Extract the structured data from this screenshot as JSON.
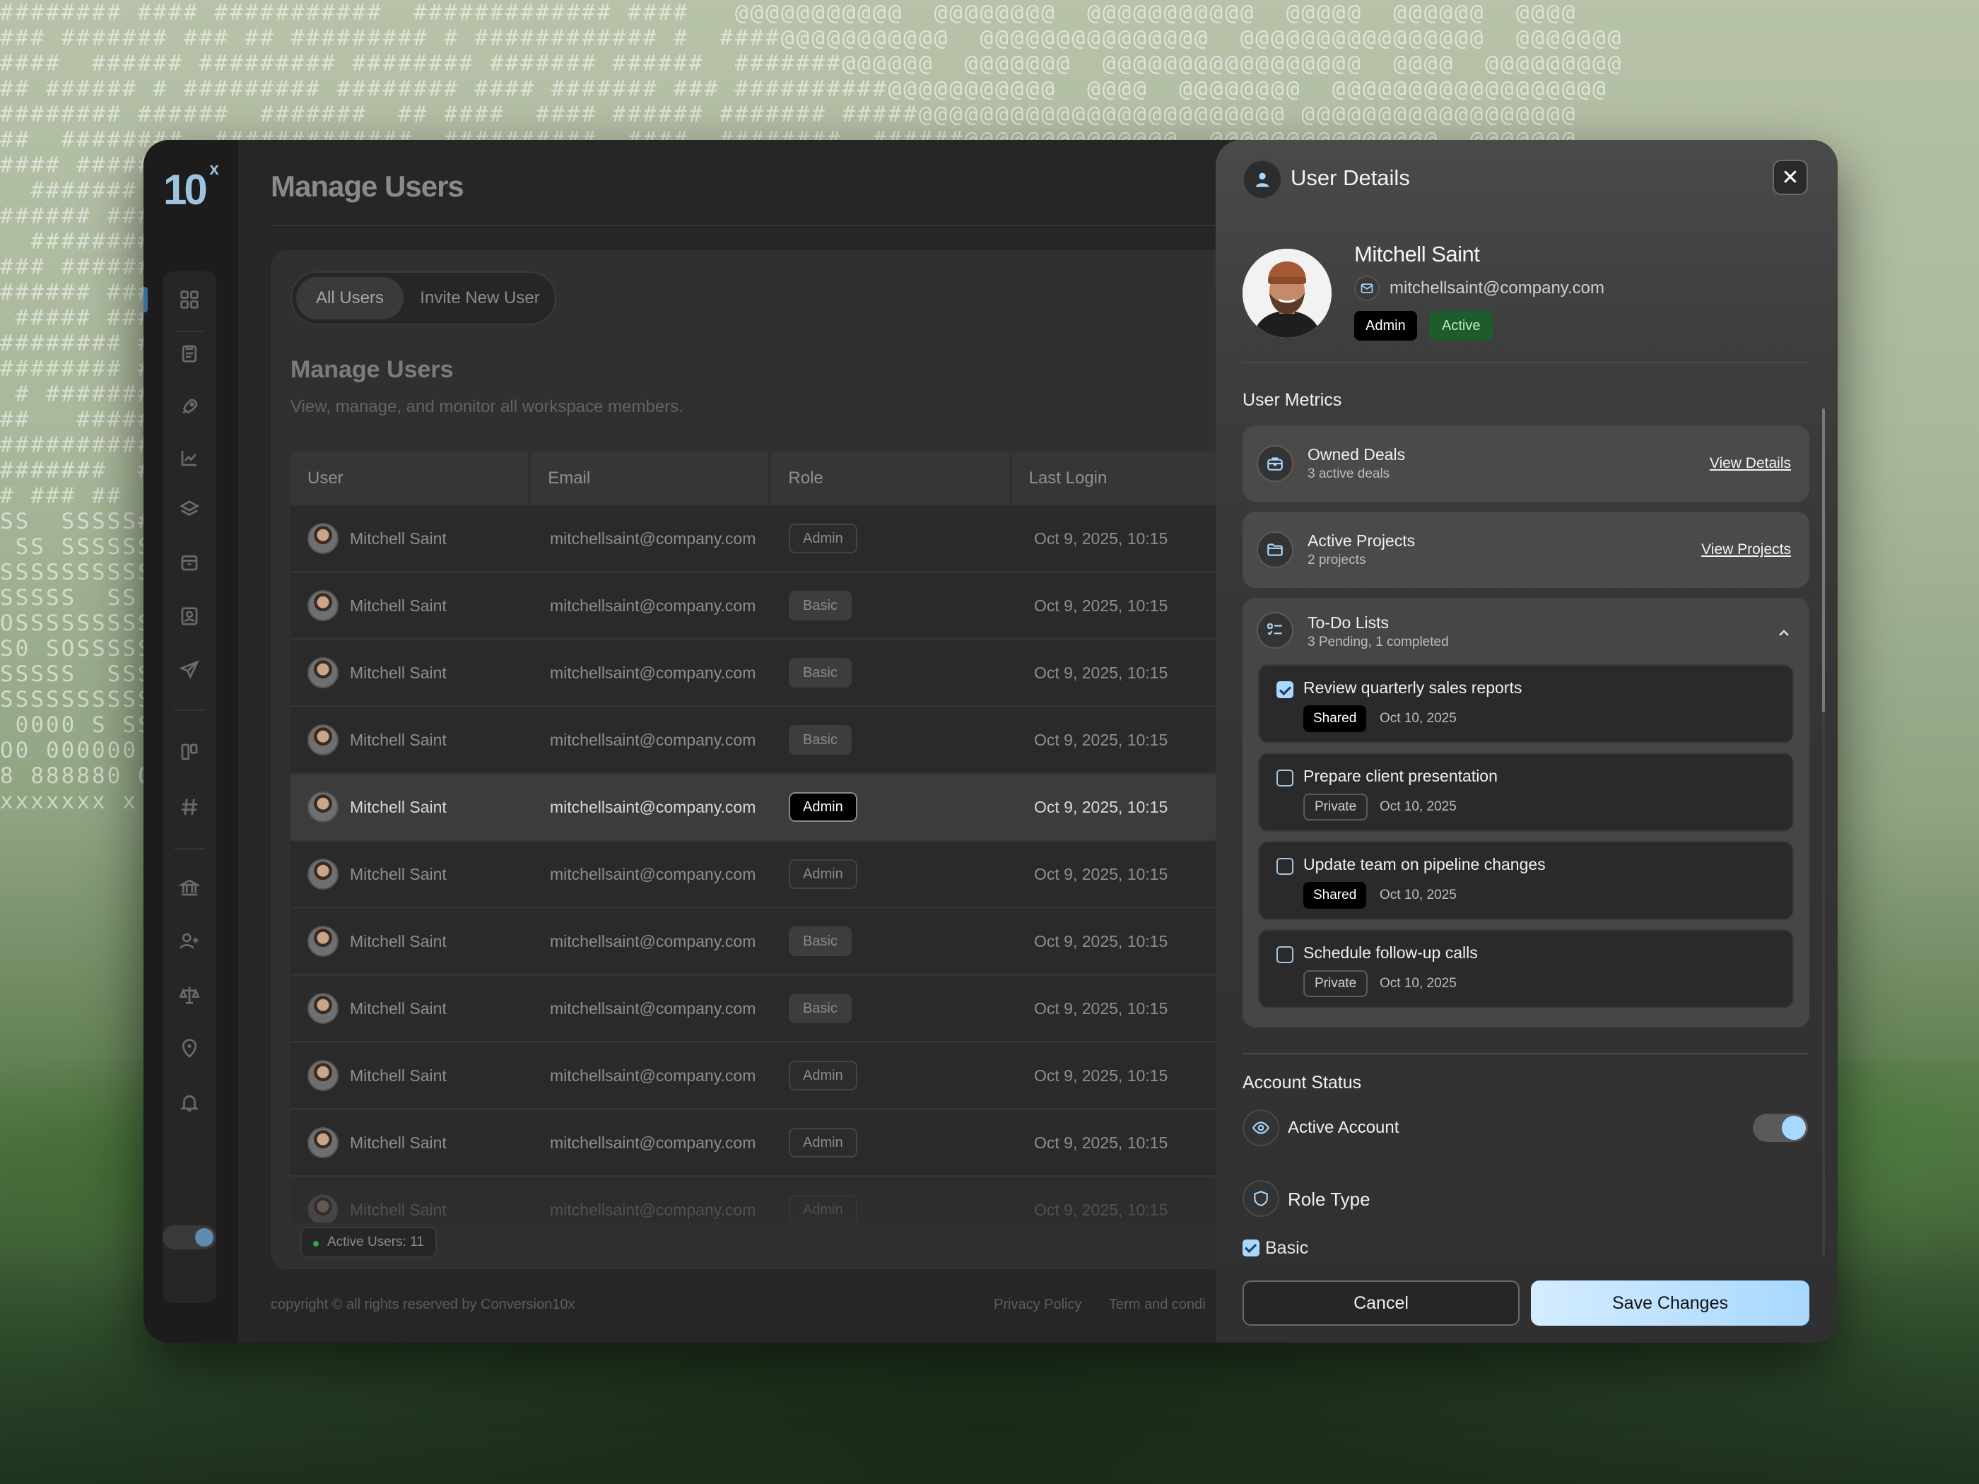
{
  "brand": {
    "logo_main": "10",
    "logo_sup": "x"
  },
  "page": {
    "title": "Manage Users"
  },
  "tabs": {
    "all_users": "All Users",
    "invite": "Invite New User"
  },
  "card": {
    "title": "Manage Users",
    "subtitle": "View, manage, and monitor all workspace members."
  },
  "table": {
    "columns": [
      "User",
      "Email",
      "Role",
      "Last Login"
    ],
    "rows": [
      {
        "name": "Mitchell Saint",
        "email": "mitchellsaint@company.com",
        "role": "Admin",
        "last_login": "Oct 9, 2025, 10:15"
      },
      {
        "name": "Mitchell Saint",
        "email": "mitchellsaint@company.com",
        "role": "Basic",
        "last_login": "Oct 9, 2025, 10:15"
      },
      {
        "name": "Mitchell Saint",
        "email": "mitchellsaint@company.com",
        "role": "Basic",
        "last_login": "Oct 9, 2025, 10:15"
      },
      {
        "name": "Mitchell Saint",
        "email": "mitchellsaint@company.com",
        "role": "Basic",
        "last_login": "Oct 9, 2025, 10:15"
      },
      {
        "name": "Mitchell Saint",
        "email": "mitchellsaint@company.com",
        "role": "Admin",
        "last_login": "Oct 9, 2025, 10:15"
      },
      {
        "name": "Mitchell Saint",
        "email": "mitchellsaint@company.com",
        "role": "Admin",
        "last_login": "Oct 9, 2025, 10:15"
      },
      {
        "name": "Mitchell Saint",
        "email": "mitchellsaint@company.com",
        "role": "Basic",
        "last_login": "Oct 9, 2025, 10:15"
      },
      {
        "name": "Mitchell Saint",
        "email": "mitchellsaint@company.com",
        "role": "Basic",
        "last_login": "Oct 9, 2025, 10:15"
      },
      {
        "name": "Mitchell Saint",
        "email": "mitchellsaint@company.com",
        "role": "Admin",
        "last_login": "Oct 9, 2025, 10:15"
      },
      {
        "name": "Mitchell Saint",
        "email": "mitchellsaint@company.com",
        "role": "Admin",
        "last_login": "Oct 9, 2025, 10:15"
      },
      {
        "name": "Mitchell Saint",
        "email": "mitchellsaint@company.com",
        "role": "Admin",
        "last_login": "Oct 9, 2025, 10:15"
      }
    ],
    "highlighted_row": 4,
    "active_users": "Active Users: 11"
  },
  "footer": {
    "copyright": "copyright © all rights reserved by Conversion10x",
    "privacy": "Privacy Policy",
    "terms": "Term and condi"
  },
  "panel": {
    "title": "User Details",
    "name": "Mitchell Saint",
    "email": "mitchellsaint@company.com",
    "role_tag": "Admin",
    "status_tag": "Active",
    "metrics_title": "User Metrics",
    "owned_deals": {
      "title": "Owned Deals",
      "sub": "3 active deals",
      "link": "View Details"
    },
    "active_projects": {
      "title": "Active Projects",
      "sub": "2 projects",
      "link": "View Projects"
    },
    "todo": {
      "title": "To-Do Lists",
      "sub": "3 Pending, 1 completed",
      "items": [
        {
          "title": "Review quarterly sales reports",
          "tag": "Shared",
          "date": "Oct 10, 2025",
          "checked": true
        },
        {
          "title": "Prepare client presentation",
          "tag": "Private",
          "date": "Oct 10, 2025",
          "checked": false
        },
        {
          "title": "Update team on pipeline changes",
          "tag": "Shared",
          "date": "Oct 10, 2025",
          "checked": false
        },
        {
          "title": "Schedule follow-up calls",
          "tag": "Private",
          "date": "Oct 10, 2025",
          "checked": false
        }
      ]
    },
    "account_status_title": "Account Status",
    "active_account": "Active Account",
    "active_account_on": true,
    "role_type_title": "Role Type",
    "role_option": "Basic",
    "cancel": "Cancel",
    "save": "Save Changes"
  },
  "colors": {
    "accent": "#a8d8ff",
    "active_green": "#1d5d2c",
    "logo": "#9dc4de"
  },
  "icons": {
    "sidebar": [
      "grid-icon",
      "clipboard-icon",
      "rocket-icon",
      "chart-icon",
      "layers-icon",
      "archive-icon",
      "contact-icon",
      "send-icon",
      "kanban-icon",
      "hash-icon",
      "bank-icon",
      "user-plus-icon",
      "scale-icon",
      "location-pin-icon",
      "bell-icon"
    ]
  }
}
